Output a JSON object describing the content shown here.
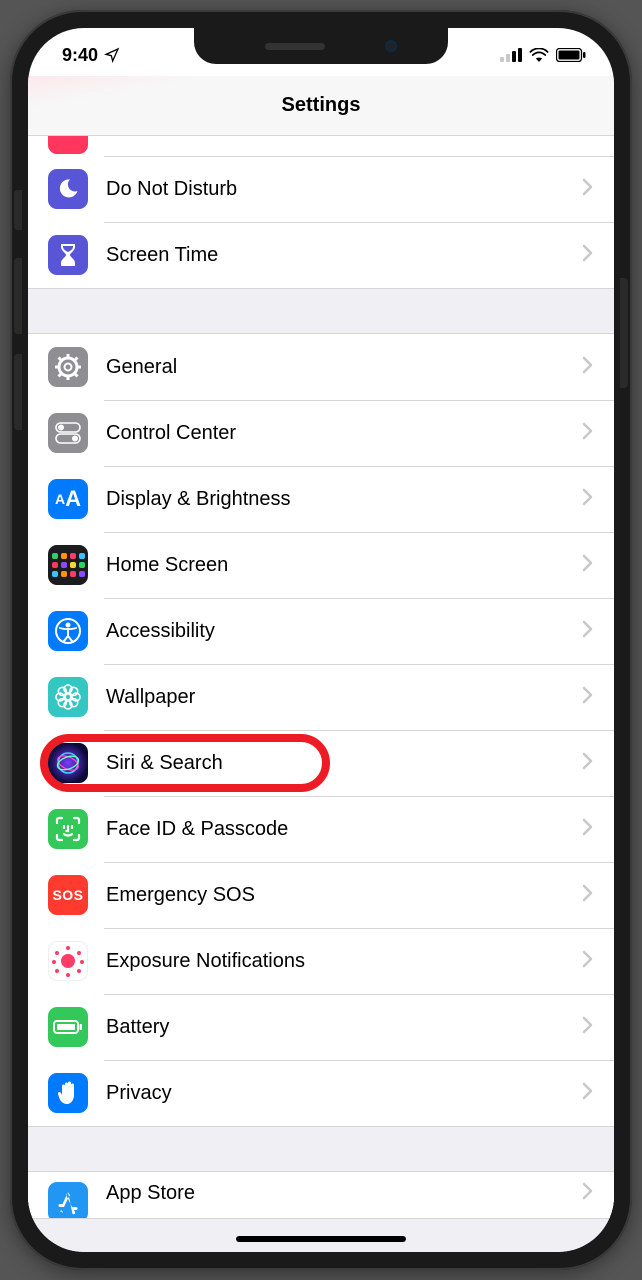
{
  "status": {
    "time": "9:40"
  },
  "header": {
    "title": "Settings"
  },
  "groups": [
    {
      "rows": [
        {
          "id": "dnd",
          "label": "Do Not Disturb",
          "icon": "moon",
          "bg": "bg-purple"
        },
        {
          "id": "screentime",
          "label": "Screen Time",
          "icon": "hourglass",
          "bg": "bg-purple"
        }
      ]
    },
    {
      "rows": [
        {
          "id": "general",
          "label": "General",
          "icon": "gear",
          "bg": "bg-gray"
        },
        {
          "id": "control",
          "label": "Control Center",
          "icon": "switches",
          "bg": "bg-gray"
        },
        {
          "id": "display",
          "label": "Display & Brightness",
          "icon": "aa",
          "bg": "bg-blue"
        },
        {
          "id": "home",
          "label": "Home Screen",
          "icon": "grid",
          "bg": "bg-grid"
        },
        {
          "id": "access",
          "label": "Accessibility",
          "icon": "person",
          "bg": "bg-blue"
        },
        {
          "id": "wallpaper",
          "label": "Wallpaper",
          "icon": "flower",
          "bg": "bg-teal"
        },
        {
          "id": "siri",
          "label": "Siri & Search",
          "icon": "siri",
          "bg": "bg-siri",
          "highlighted": true
        },
        {
          "id": "faceid",
          "label": "Face ID & Passcode",
          "icon": "face",
          "bg": "bg-green"
        },
        {
          "id": "sos",
          "label": "Emergency SOS",
          "icon": "sos",
          "bg": "bg-red"
        },
        {
          "id": "exposure",
          "label": "Exposure Notifications",
          "icon": "exposure",
          "bg": "bg-white"
        },
        {
          "id": "battery",
          "label": "Battery",
          "icon": "battery",
          "bg": "bg-green"
        },
        {
          "id": "privacy",
          "label": "Privacy",
          "icon": "hand",
          "bg": "bg-hand"
        }
      ]
    },
    {
      "rows": [
        {
          "id": "appstore",
          "label": "App Store",
          "icon": "appstore",
          "bg": "bg-lblue"
        }
      ]
    }
  ]
}
